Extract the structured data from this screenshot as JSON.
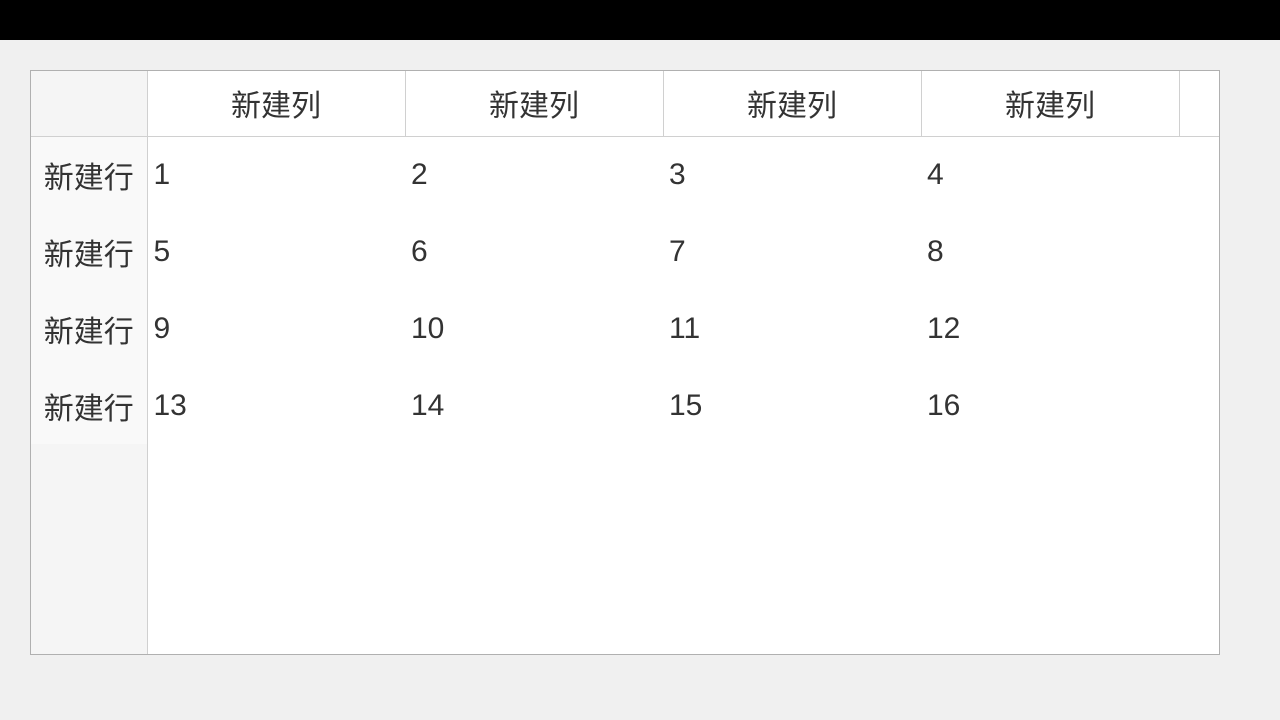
{
  "table": {
    "column_headers": [
      "新建列",
      "新建列",
      "新建列",
      "新建列"
    ],
    "row_headers": [
      "新建行",
      "新建行",
      "新建行",
      "新建行"
    ],
    "rows": [
      [
        "1",
        "2",
        "3",
        "4"
      ],
      [
        "5",
        "6",
        "7",
        "8"
      ],
      [
        "9",
        "10",
        "11",
        "12"
      ],
      [
        "13",
        "14",
        "15",
        "16"
      ]
    ]
  },
  "chart_data": {
    "type": "table",
    "title": "",
    "columns": [
      "新建列",
      "新建列",
      "新建列",
      "新建列"
    ],
    "row_labels": [
      "新建行",
      "新建行",
      "新建行",
      "新建行"
    ],
    "values": [
      [
        1,
        2,
        3,
        4
      ],
      [
        5,
        6,
        7,
        8
      ],
      [
        9,
        10,
        11,
        12
      ],
      [
        13,
        14,
        15,
        16
      ]
    ]
  }
}
